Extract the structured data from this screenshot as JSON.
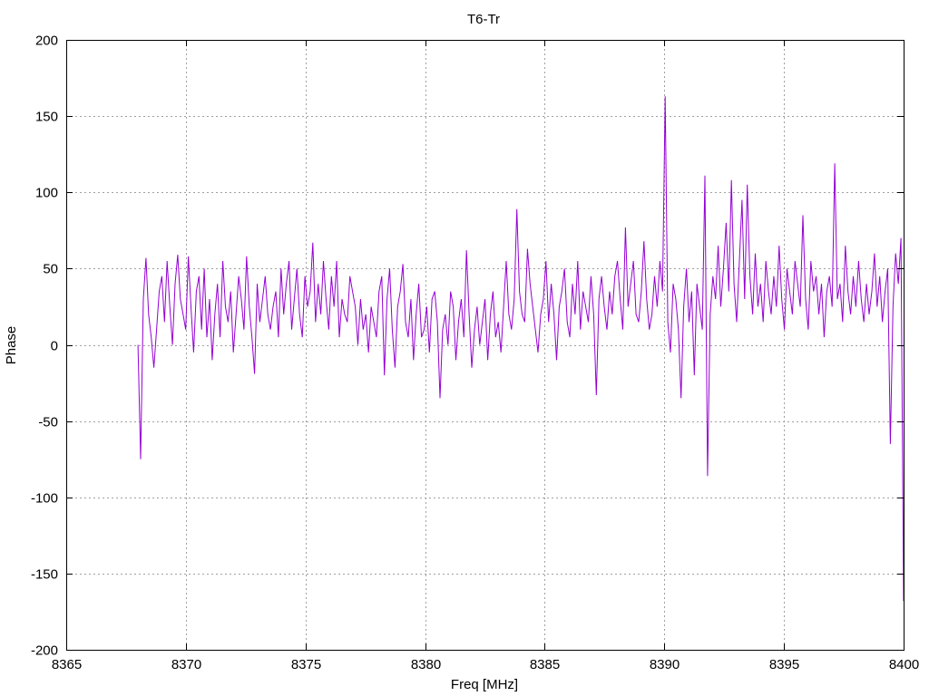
{
  "chart_data": {
    "type": "line",
    "title": "T6-Tr",
    "xlabel": "Freq [MHz]",
    "ylabel": "Phase",
    "xlim": [
      8365,
      8400
    ],
    "ylim": [
      -200,
      200
    ],
    "xticks": [
      8365,
      8370,
      8375,
      8380,
      8385,
      8390,
      8395,
      8400
    ],
    "yticks": [
      -200,
      -150,
      -100,
      -50,
      0,
      50,
      100,
      150,
      200
    ],
    "grid": true,
    "line_color": "#9400d3",
    "series": [
      {
        "x_start": 8368.0,
        "x_end": 8400.0,
        "y": [
          0,
          -75,
          30,
          57,
          20,
          5,
          -15,
          10,
          35,
          45,
          15,
          55,
          25,
          0,
          40,
          59,
          30,
          20,
          10,
          58,
          25,
          -5,
          35,
          45,
          10,
          50,
          5,
          30,
          -10,
          20,
          40,
          5,
          55,
          25,
          15,
          35,
          -5,
          20,
          45,
          30,
          10,
          58,
          25,
          5,
          -19,
          40,
          15,
          30,
          45,
          20,
          10,
          25,
          35,
          5,
          50,
          20,
          40,
          55,
          10,
          30,
          50,
          20,
          5,
          45,
          25,
          35,
          67,
          15,
          40,
          20,
          55,
          30,
          10,
          45,
          25,
          55,
          5,
          30,
          20,
          15,
          45,
          35,
          25,
          0,
          30,
          10,
          20,
          -5,
          25,
          15,
          5,
          35,
          45,
          -20,
          30,
          50,
          10,
          -15,
          25,
          35,
          53,
          15,
          5,
          30,
          -10,
          20,
          40,
          5,
          10,
          25,
          -5,
          30,
          35,
          15,
          -35,
          10,
          20,
          0,
          35,
          25,
          -10,
          15,
          30,
          5,
          62,
          20,
          -15,
          10,
          25,
          0,
          15,
          30,
          -10,
          20,
          35,
          5,
          15,
          -5,
          25,
          55,
          20,
          10,
          30,
          89,
          35,
          20,
          15,
          63,
          40,
          25,
          10,
          -5,
          20,
          30,
          55,
          15,
          40,
          20,
          -10,
          25,
          35,
          50,
          15,
          5,
          40,
          20,
          55,
          10,
          35,
          25,
          15,
          45,
          20,
          -33,
          30,
          45,
          25,
          10,
          35,
          20,
          45,
          55,
          30,
          10,
          77,
          25,
          40,
          55,
          20,
          15,
          35,
          68,
          30,
          10,
          20,
          45,
          25,
          55,
          35,
          163,
          15,
          -5,
          40,
          30,
          10,
          -35,
          25,
          50,
          15,
          35,
          -20,
          40,
          25,
          10,
          111,
          -86,
          20,
          45,
          30,
          65,
          25,
          50,
          80,
          35,
          108,
          40,
          15,
          55,
          95,
          30,
          105,
          45,
          20,
          60,
          25,
          40,
          15,
          55,
          35,
          20,
          45,
          25,
          65,
          30,
          10,
          50,
          35,
          20,
          55,
          40,
          25,
          85,
          30,
          10,
          55,
          35,
          45,
          20,
          40,
          5,
          35,
          45,
          25,
          119,
          30,
          40,
          15,
          65,
          35,
          20,
          45,
          25,
          55,
          30,
          15,
          40,
          20,
          35,
          60,
          25,
          45,
          15,
          35,
          50,
          -65,
          25,
          60,
          40,
          70,
          -168
        ]
      }
    ]
  }
}
